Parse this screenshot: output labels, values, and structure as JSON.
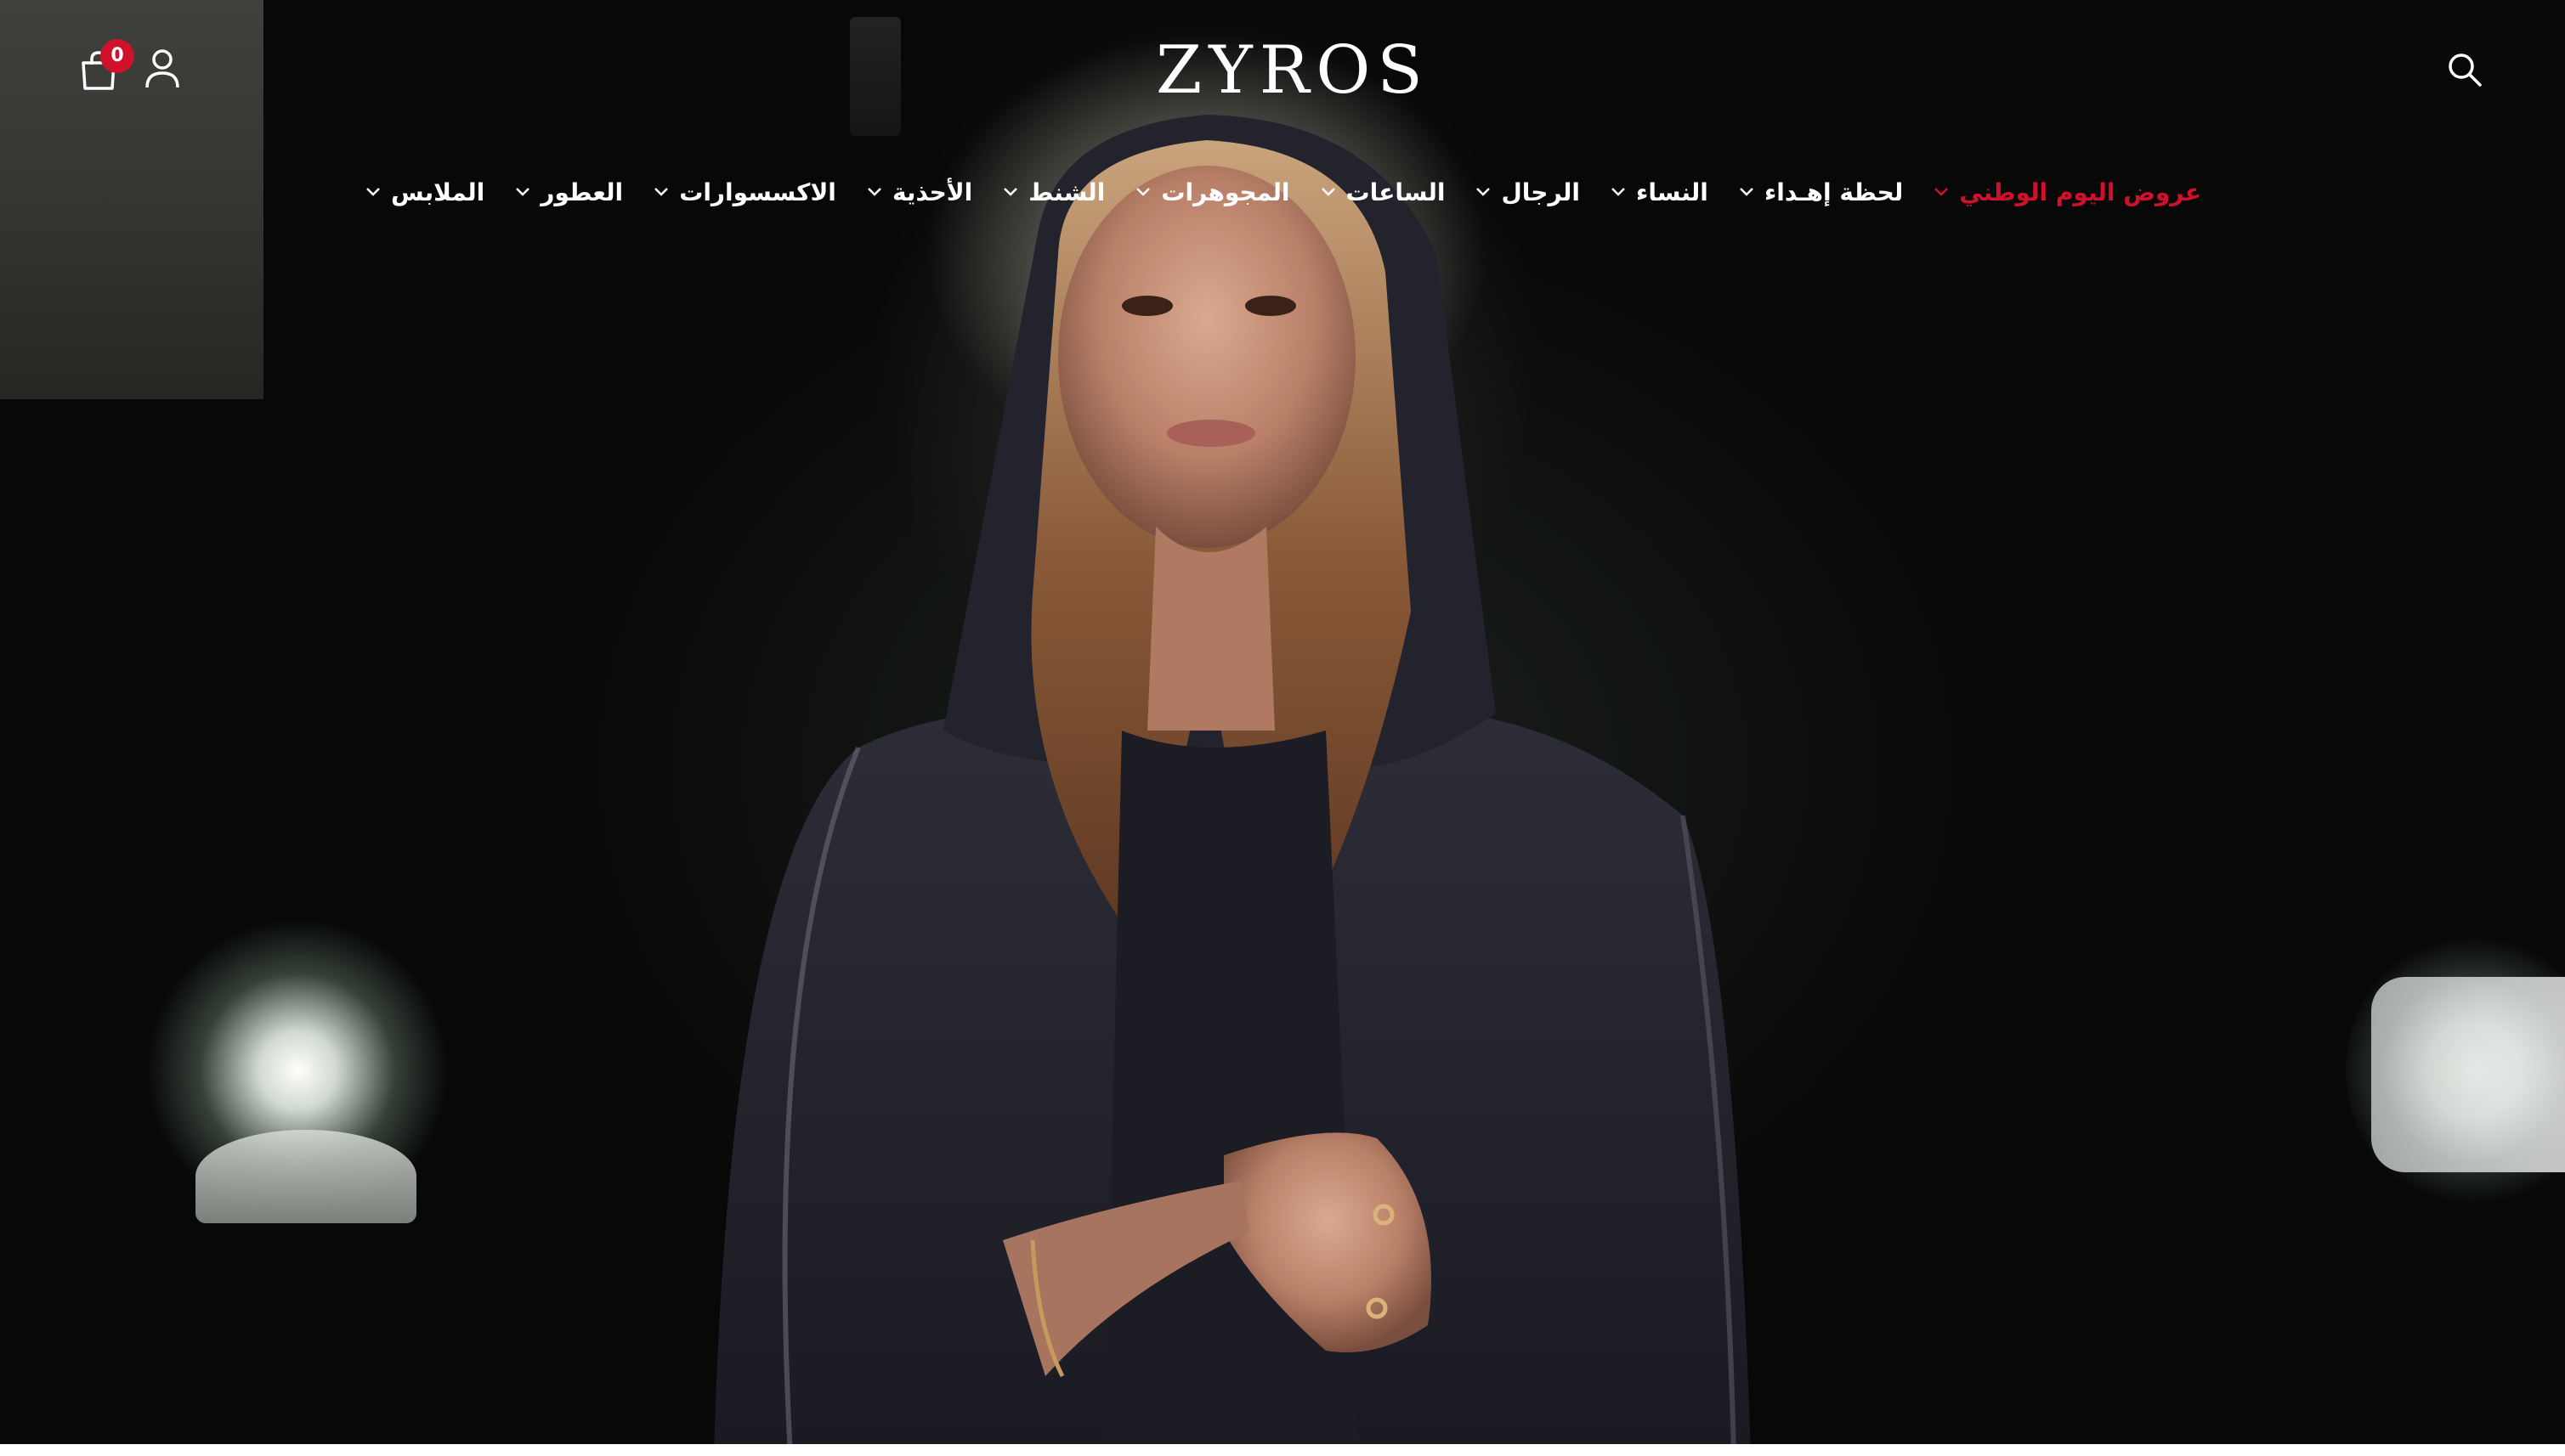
{
  "brand": {
    "logo": "ZYROS",
    "accent": "#d0112b"
  },
  "header": {
    "cart_count": "0",
    "icons": [
      "shopping-bag-icon",
      "user-icon",
      "search-icon"
    ]
  },
  "nav": {
    "items": [
      {
        "label": "عروض اليوم الوطني",
        "has_dropdown": true,
        "highlight": true
      },
      {
        "label": "لحظة إهـداء",
        "has_dropdown": true
      },
      {
        "label": "النساء",
        "has_dropdown": true
      },
      {
        "label": "الرجال",
        "has_dropdown": true
      },
      {
        "label": "الساعات",
        "has_dropdown": true
      },
      {
        "label": "المجوهرات",
        "has_dropdown": true
      },
      {
        "label": "الشنط",
        "has_dropdown": true
      },
      {
        "label": "الأحذية",
        "has_dropdown": true
      },
      {
        "label": "الاكسسوارات",
        "has_dropdown": true
      },
      {
        "label": "العطور",
        "has_dropdown": true
      },
      {
        "label": "الملابس",
        "has_dropdown": true
      }
    ]
  }
}
